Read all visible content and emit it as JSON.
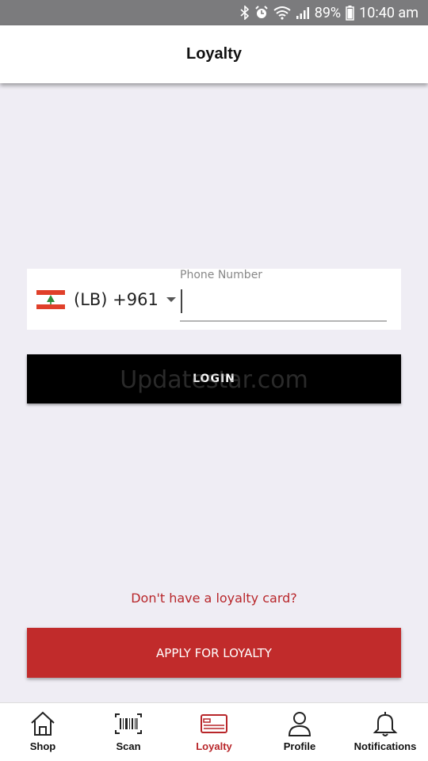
{
  "status_bar": {
    "battery": "89%",
    "time": "10:40 am"
  },
  "header": {
    "title": "Loyalty"
  },
  "phone": {
    "country_code": "(LB) +961",
    "label": "Phone Number",
    "value": "",
    "placeholder": ""
  },
  "login": {
    "label": "LOGIN"
  },
  "watermark": "Updatestar.com",
  "no_card": {
    "text": "Don't have a loyalty card?"
  },
  "apply": {
    "label": "APPLY FOR LOYALTY"
  },
  "nav": {
    "items": [
      {
        "label": "Shop",
        "icon": "home-icon"
      },
      {
        "label": "Scan",
        "icon": "barcode-icon"
      },
      {
        "label": "Loyalty",
        "icon": "loyalty-card-icon",
        "active": true
      },
      {
        "label": "Profile",
        "icon": "user-icon"
      },
      {
        "label": "Notifications",
        "icon": "bell-icon"
      }
    ]
  },
  "colors": {
    "accent": "#c12b2b",
    "link": "#b8262a",
    "background": "#efedf4"
  }
}
